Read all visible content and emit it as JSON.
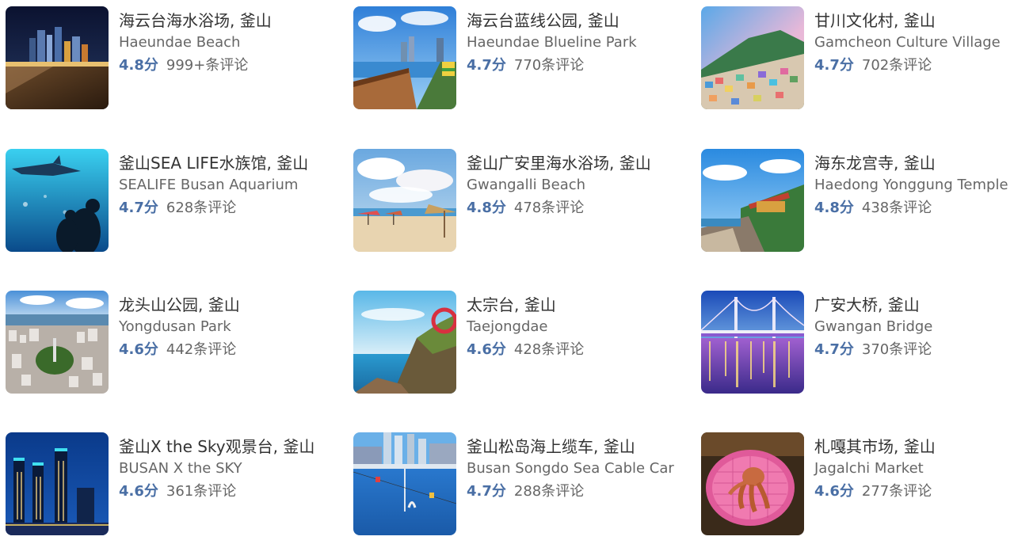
{
  "attractions": [
    {
      "title": "海云台海水浴场, 釜山",
      "subtitle": "Haeundae Beach",
      "score": "4.8分",
      "reviews": "999+条评论",
      "image": "night-beach-skyline"
    },
    {
      "title": "海云台蓝线公园, 釜山",
      "subtitle": "Haeundae Blueline Park",
      "score": "4.7分",
      "reviews": "770条评论",
      "image": "coastal-boardwalk"
    },
    {
      "title": "甘川文化村, 釜山",
      "subtitle": "Gamcheon Culture Village",
      "score": "4.7分",
      "reviews": "702条评论",
      "image": "hillside-village"
    },
    {
      "title": "釜山SEA LIFE水族馆, 釜山",
      "subtitle": "SEALIFE Busan Aquarium",
      "score": "4.7分",
      "reviews": "628条评论",
      "image": "aquarium-shark"
    },
    {
      "title": "釜山广安里海水浴场, 釜山",
      "subtitle": "Gwangalli Beach",
      "score": "4.8分",
      "reviews": "478条评论",
      "image": "beach-umbrellas"
    },
    {
      "title": "海东龙宫寺, 釜山",
      "subtitle": "Haedong Yonggung Temple",
      "score": "4.8分",
      "reviews": "438条评论",
      "image": "seaside-temple"
    },
    {
      "title": "龙头山公园, 釜山",
      "subtitle": "Yongdusan Park",
      "score": "4.6分",
      "reviews": "442条评论",
      "image": "city-aerial"
    },
    {
      "title": "太宗台, 釜山",
      "subtitle": "Taejongdae",
      "score": "4.6分",
      "reviews": "428条评论",
      "image": "cliff-sea"
    },
    {
      "title": "广安大桥, 釜山",
      "subtitle": "Gwangan Bridge",
      "score": "4.7分",
      "reviews": "370条评论",
      "image": "night-bridge"
    },
    {
      "title": "釜山X the Sky观景台, 釜山",
      "subtitle": "BUSAN X the SKY",
      "score": "4.6分",
      "reviews": "361条评论",
      "image": "night-towers"
    },
    {
      "title": "釜山松岛海上缆车, 釜山",
      "subtitle": "Busan Songdo Sea Cable Car",
      "score": "4.7分",
      "reviews": "288条评论",
      "image": "cable-car-bay"
    },
    {
      "title": "札嘎其市场, 釜山",
      "subtitle": "Jagalchi Market",
      "score": "4.6分",
      "reviews": "277条评论",
      "image": "octopus-basket"
    }
  ]
}
